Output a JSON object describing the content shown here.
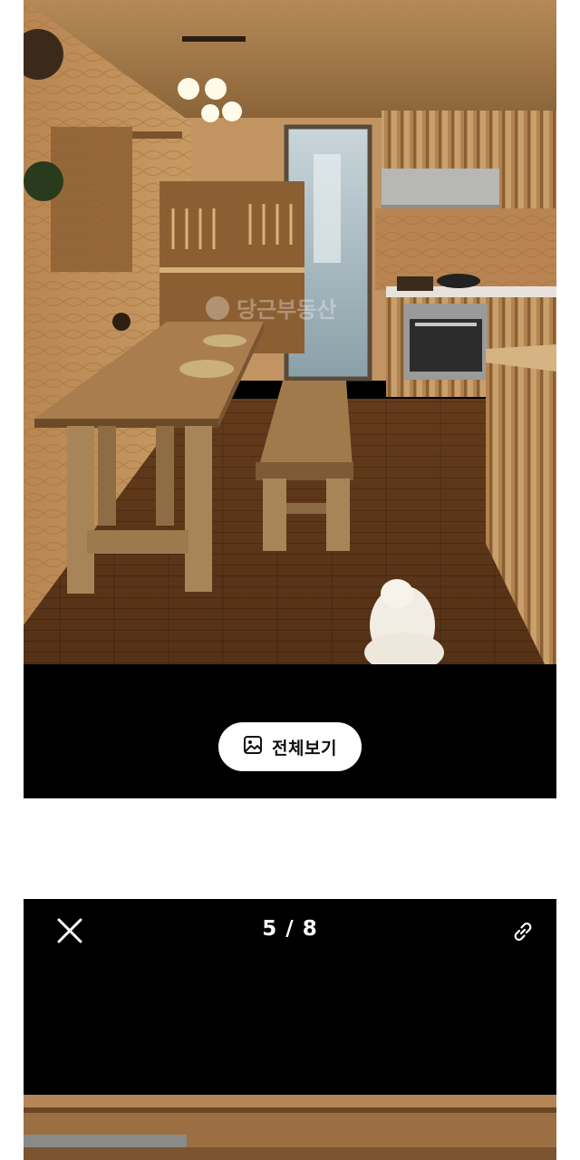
{
  "viewer_top": {
    "view_all_label": "전체보기"
  },
  "viewer_bottom": {
    "page_counter": "5 / 8"
  },
  "photo": {
    "watermark": "당근부동산"
  },
  "icons": {
    "view_all": "image-icon",
    "close": "close-icon",
    "share": "link-icon"
  }
}
